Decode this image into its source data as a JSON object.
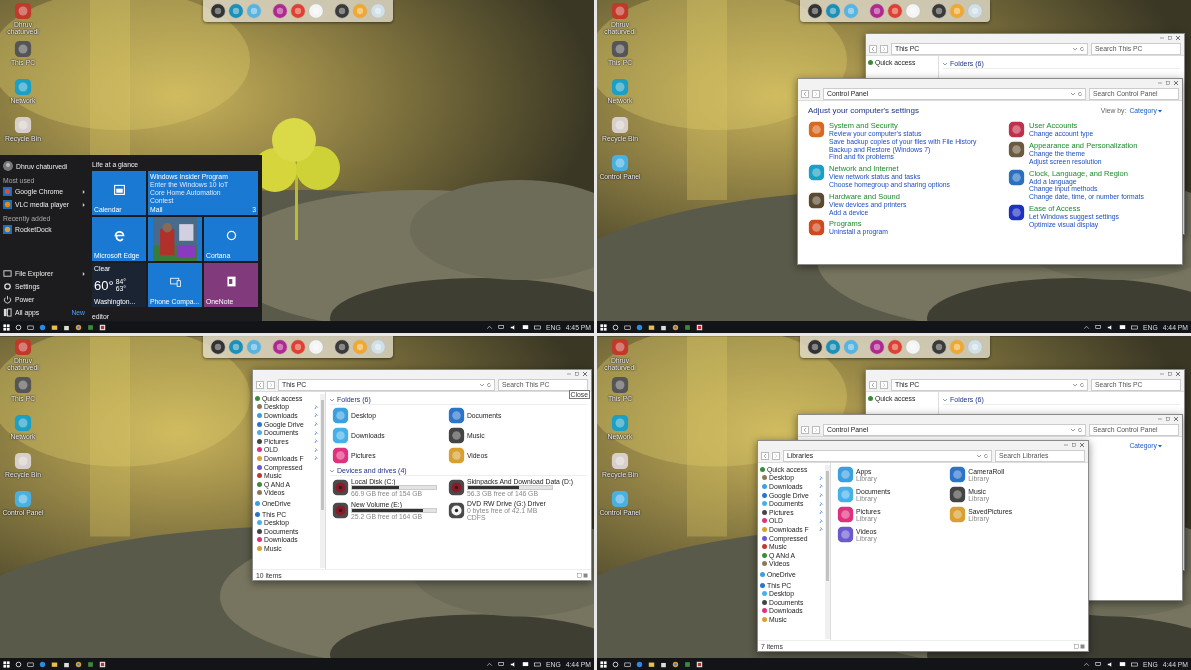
{
  "screens": [
    {
      "desktop_icons": [
        {
          "label": "Dhruv chaturvedi"
        },
        {
          "label": "This PC"
        },
        {
          "label": "Network"
        },
        {
          "label": "Recycle Bin"
        }
      ],
      "windows": [
        {
          "kind": "start_menu",
          "user": "Dhruv chaturvedi",
          "sections": [
            {
              "heading": "Most used",
              "apps": [
                {
                  "name": "Google Chrome",
                  "has_submenu": true
                },
                {
                  "name": "VLC media player",
                  "has_submenu": true
                }
              ]
            },
            {
              "heading": "Recently added",
              "apps": [
                {
                  "name": "RocketDock",
                  "has_submenu": false
                }
              ]
            }
          ],
          "places": [
            {
              "name": "File Explorer",
              "has_submenu": true
            },
            {
              "name": "Settings",
              "has_submenu": false
            },
            {
              "name": "Power",
              "has_submenu": false
            },
            {
              "name": "All apps",
              "has_submenu": false
            }
          ],
          "new_badge": "New",
          "tile_group": "Life at a glance",
          "tiles": [
            {
              "kind": "calendar",
              "label": "Calendar"
            },
            {
              "kind": "mail",
              "title": "Windows Insider Program",
              "text": "Enter the Windows 10 IoT Core Home Automation Contest",
              "label": "Mail",
              "count": "3"
            },
            {
              "kind": "edge",
              "label": "Microsoft Edge"
            },
            {
              "kind": "picture"
            },
            {
              "kind": "cortana",
              "label": "Cortana"
            },
            {
              "kind": "weather",
              "condition": "Clear",
              "temperature": "60°",
              "high": "84°",
              "low": "63°",
              "label": "Washington..."
            },
            {
              "kind": "phone",
              "label": "Phone Compa..."
            },
            {
              "kind": "onenote",
              "label": "OneNote"
            }
          ],
          "second_group": "editor"
        }
      ],
      "taskbar": {
        "language": "ENG",
        "time": "4:45 PM"
      }
    },
    {
      "desktop_icons": [
        {
          "label": "Dhruv chaturvedi"
        },
        {
          "label": "This PC"
        },
        {
          "label": "Network"
        },
        {
          "label": "Recycle Bin"
        },
        {
          "label": "Control Panel"
        }
      ],
      "windows": [
        {
          "kind": "explorer",
          "address": "This PC",
          "search_placeholder": "Search This PC",
          "nav": [
            {
              "label": "Quick access"
            }
          ],
          "sections": [
            {
              "title": "Folders (6)"
            }
          ]
        },
        {
          "kind": "control_panel",
          "address": "Control Panel",
          "search_placeholder": "Search Control Panel",
          "heading": "Adjust your computer's settings",
          "view_by_label": "View by:",
          "view_by": "Category",
          "columns": [
            [
              {
                "title": "System and Security",
                "links": [
                  "Review your computer's status",
                  "Save backup copies of your files with File History",
                  "Backup and Restore (Windows 7)",
                  "Find and fix problems"
                ]
              },
              {
                "title": "Network and Internet",
                "links": [
                  "View network status and tasks",
                  "Choose homegroup and sharing options"
                ]
              },
              {
                "title": "Hardware and Sound",
                "links": [
                  "View devices and printers",
                  "Add a device"
                ]
              },
              {
                "title": "Programs",
                "links": [
                  "Uninstall a program"
                ]
              }
            ],
            [
              {
                "title": "User Accounts",
                "links": [
                  "Change account type"
                ]
              },
              {
                "title": "Appearance and Personalization",
                "links": [
                  "Change the theme",
                  "Adjust screen resolution"
                ]
              },
              {
                "title": "Clock, Language, and Region",
                "links": [
                  "Add a language",
                  "Change input methods",
                  "Change date, time, or number formats"
                ]
              },
              {
                "title": "Ease of Access",
                "links": [
                  "Let Windows suggest settings",
                  "Optimize visual display"
                ]
              }
            ]
          ]
        }
      ],
      "taskbar": {
        "language": "ENG",
        "time": "4:44 PM"
      }
    },
    {
      "desktop_icons": [
        {
          "label": "Dhruv chaturvedi"
        },
        {
          "label": "This PC"
        },
        {
          "label": "Network"
        },
        {
          "label": "Recycle Bin"
        },
        {
          "label": "Control Panel"
        }
      ],
      "windows": [
        {
          "kind": "explorer",
          "address": "This PC",
          "search_placeholder": "Search This PC",
          "tooltip": "Close",
          "nav": [
            {
              "label": "Quick access",
              "children": [
                {
                  "label": "Desktop",
                  "pinned": true
                },
                {
                  "label": "Downloads",
                  "pinned": true
                },
                {
                  "label": "Google Drive",
                  "pinned": true
                },
                {
                  "label": "Documents",
                  "pinned": true
                },
                {
                  "label": "Pictures",
                  "pinned": true
                },
                {
                  "label": "OLD",
                  "pinned": true
                },
                {
                  "label": "Downloads F",
                  "pinned": true
                },
                {
                  "label": "Compressed",
                  "pinned": false
                },
                {
                  "label": "Music",
                  "pinned": false
                },
                {
                  "label": "Q ANd A",
                  "pinned": false
                },
                {
                  "label": "Videos",
                  "pinned": false
                }
              ]
            },
            {
              "label": "OneDrive"
            },
            {
              "label": "This PC",
              "children": [
                {
                  "label": "Desktop",
                  "pinned": false
                },
                {
                  "label": "Documents",
                  "pinned": false
                },
                {
                  "label": "Downloads",
                  "pinned": false
                },
                {
                  "label": "Music",
                  "pinned": false
                }
              ]
            }
          ],
          "sections": [
            {
              "title": "Folders (6)",
              "items": [
                {
                  "name": "Desktop"
                },
                {
                  "name": "Documents"
                },
                {
                  "name": "Downloads"
                },
                {
                  "name": "Music"
                },
                {
                  "name": "Pictures"
                },
                {
                  "name": "Videos"
                }
              ]
            },
            {
              "title": "Devices and drives (4)",
              "items": [
                {
                  "name": "Local Disk (C:)",
                  "level": 0.56,
                  "detail": "66.9 GB free of 154 GB"
                },
                {
                  "name": "Skinpacks And Download Data (D:)",
                  "level": 0.61,
                  "detail": "56.3 GB free of 146 GB"
                },
                {
                  "name": "New Volume (E:)",
                  "level": 0.85,
                  "detail": "25.2 GB free of 164 GB"
                },
                {
                  "name": "DVD RW Drive (G:) Driver",
                  "detail": "0 bytes free of 42.1 MB",
                  "extra": "CDFS"
                }
              ]
            }
          ],
          "status": "10 items"
        }
      ],
      "taskbar": {
        "language": "ENG",
        "time": "4:44 PM"
      }
    },
    {
      "desktop_icons": [
        {
          "label": "Dhruv chaturvedi"
        },
        {
          "label": "This PC"
        },
        {
          "label": "Network"
        },
        {
          "label": "Recycle Bin"
        },
        {
          "label": "Control Panel"
        }
      ],
      "windows": [
        {
          "kind": "explorer",
          "address": "This PC",
          "search_placeholder": "Search This PC",
          "nav": [
            {
              "label": "Quick access"
            }
          ],
          "sections": [
            {
              "title": "Folders (6)"
            }
          ]
        },
        {
          "kind": "control_panel",
          "address": "Control Panel",
          "search_placeholder": "Search Control Panel",
          "view_by": "Category"
        },
        {
          "kind": "explorer",
          "address": "Libraries",
          "search_placeholder": "Search Libraries",
          "nav": [
            {
              "label": "Quick access",
              "children": [
                {
                  "label": "Desktop",
                  "pinned": true
                },
                {
                  "label": "Downloads",
                  "pinned": true
                },
                {
                  "label": "Google Drive",
                  "pinned": true
                },
                {
                  "label": "Documents",
                  "pinned": true
                },
                {
                  "label": "Pictures",
                  "pinned": true
                },
                {
                  "label": "OLD",
                  "pinned": true
                },
                {
                  "label": "Downloads F",
                  "pinned": true
                },
                {
                  "label": "Compressed",
                  "pinned": false
                },
                {
                  "label": "Music",
                  "pinned": false
                },
                {
                  "label": "Q ANd A",
                  "pinned": false
                },
                {
                  "label": "Videos",
                  "pinned": false
                }
              ]
            },
            {
              "label": "OneDrive"
            },
            {
              "label": "This PC",
              "children": [
                {
                  "label": "Desktop",
                  "pinned": false
                },
                {
                  "label": "Documents",
                  "pinned": false
                },
                {
                  "label": "Downloads",
                  "pinned": false
                },
                {
                  "label": "Music",
                  "pinned": false
                }
              ]
            }
          ],
          "sections": [
            {
              "items": [
                {
                  "name": "Apps",
                  "subtitle": "Library"
                },
                {
                  "name": "CameraRoll",
                  "subtitle": "Library"
                },
                {
                  "name": "Documents",
                  "subtitle": "Library"
                },
                {
                  "name": "Music",
                  "subtitle": "Library"
                },
                {
                  "name": "Pictures",
                  "subtitle": "Library"
                },
                {
                  "name": "SavedPictures",
                  "subtitle": "Library"
                },
                {
                  "name": "Videos",
                  "subtitle": "Library"
                }
              ]
            }
          ],
          "status": "7 items"
        }
      ],
      "taskbar": {
        "language": "ENG",
        "time": "4:44 PM"
      }
    }
  ]
}
